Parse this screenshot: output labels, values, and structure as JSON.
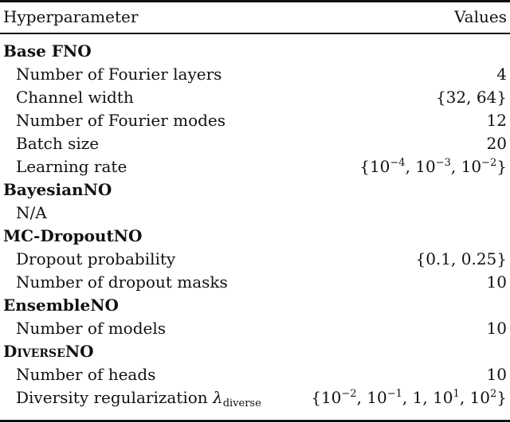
{
  "header": {
    "col1": "Hyperparameter",
    "col2": "Values"
  },
  "sections": [
    {
      "title": "Base FNO",
      "rows": [
        {
          "name": "Number of Fourier layers",
          "value": "4"
        },
        {
          "name": "Channel width",
          "value": "{32, 64}"
        },
        {
          "name": "Number of Fourier modes",
          "value": "12"
        },
        {
          "name": "Batch size",
          "value": "20"
        },
        {
          "name": "Learning rate",
          "value": "{10^-4, 10^-3, 10^-2}"
        }
      ]
    },
    {
      "title": "BayesianNO",
      "rows": [
        {
          "name": "N/A",
          "value": ""
        }
      ]
    },
    {
      "title": "MC-DropoutNO",
      "rows": [
        {
          "name": "Dropout probability",
          "value": "{0.1, 0.25}"
        },
        {
          "name": "Number of dropout masks",
          "value": "10"
        }
      ]
    },
    {
      "title": "EnsembleNO",
      "rows": [
        {
          "name": "Number of models",
          "value": "10"
        }
      ]
    },
    {
      "title": "DiverseNO",
      "title_prefix": "Diverse",
      "title_suffix": "NO",
      "rows": [
        {
          "name": "Number of heads",
          "value": "10"
        },
        {
          "name": "Diversity regularization",
          "symbol": "λ",
          "subscript": "diverse",
          "value": "{10^-2, 10^-1, 1, 10^1, 10^2}"
        }
      ]
    }
  ],
  "math": {
    "lr": {
      "open": "{10",
      "e1": "−4",
      "m1": ", 10",
      "e2": "−3",
      "m2": ", 10",
      "e3": "−2",
      "close": "}"
    },
    "div": {
      "open": "{10",
      "e1": "−2",
      "m1": ", 10",
      "e2": "−1",
      "m2": ", 1, 10",
      "e3": "1",
      "m3": ", 10",
      "e4": "2",
      "close": "}"
    }
  }
}
